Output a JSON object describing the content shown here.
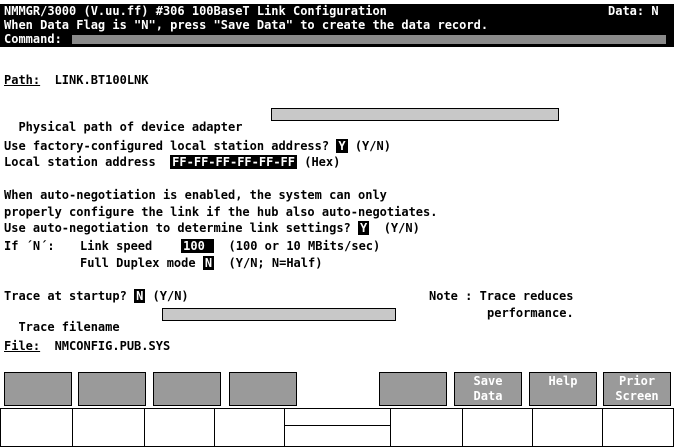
{
  "header": {
    "title": "NMMGR/3000 (V.uu.ff) #306 100BaseT Link Configuration",
    "data_flag": "Data: N",
    "message": "When Data Flag is \"N\", press \"Save Data\" to create the data record.",
    "command_label": "Command:"
  },
  "path": {
    "label": "Path:",
    "value": "LINK.BT100LNK"
  },
  "physical_path": {
    "label": "Physical path of device adapter",
    "value": ""
  },
  "factory_address": {
    "label": "Use factory-configured local station address?",
    "value": "Y",
    "hint": "(Y/N)"
  },
  "local_address": {
    "label": "Local station address",
    "value": "FF-FF-FF-FF-FF-FF",
    "hint": "(Hex)"
  },
  "auto_note": {
    "line1": "When auto-negotiation is enabled, the system can only",
    "line2": "properly configure the link if the hub also auto-negotiates."
  },
  "auto_neg": {
    "label": "Use auto-negotiation to determine link settings?",
    "value": "Y",
    "hint": "(Y/N)"
  },
  "if_n": {
    "label": "If ´N´:"
  },
  "link_speed": {
    "label": "Link speed",
    "value": "100",
    "hint": "(100 or 10 MBits/sec)"
  },
  "duplex": {
    "label": "Full Duplex mode",
    "value": "N",
    "hint": "(Y/N; N=Half)"
  },
  "trace_startup": {
    "label": "Trace at startup?",
    "value": "N",
    "hint": "(Y/N)"
  },
  "trace_file": {
    "label": "Trace filename",
    "value": ""
  },
  "note": {
    "line1": "Note : Trace reduces",
    "line2": "performance."
  },
  "file": {
    "label": "File:",
    "value": "NMCONFIG.PUB.SYS"
  },
  "function_keys": [
    {
      "line1": "",
      "line2": ""
    },
    {
      "line1": "",
      "line2": ""
    },
    {
      "line1": "",
      "line2": ""
    },
    {
      "line1": "",
      "line2": ""
    },
    {
      "line1": "",
      "line2": ""
    },
    {
      "line1": "",
      "line2": ""
    },
    {
      "line1": "Save",
      "line2": "Data"
    },
    {
      "line1": "Help",
      "line2": ""
    },
    {
      "line1": "Prior",
      "line2": "Screen"
    }
  ]
}
